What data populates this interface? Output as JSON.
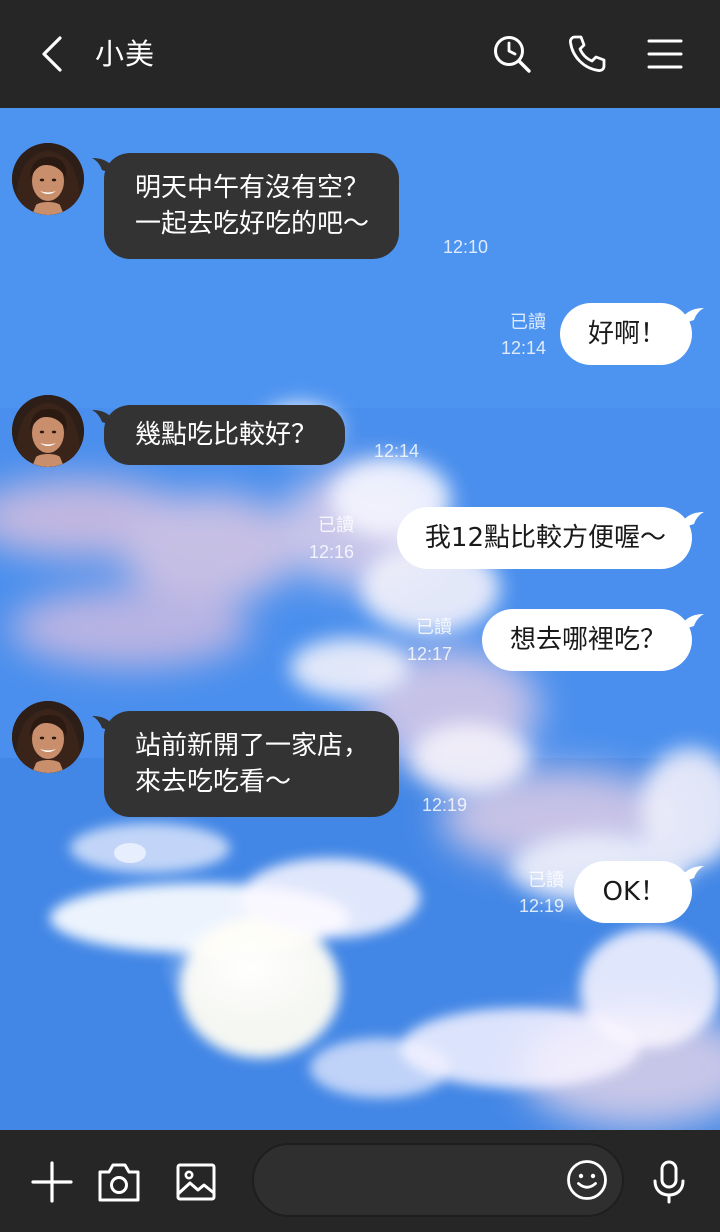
{
  "header": {
    "contact_name": "小美",
    "icons": [
      "back-chevron-icon",
      "search-clock-icon",
      "phone-icon",
      "menu-icon"
    ]
  },
  "messages": [
    {
      "from": "them",
      "lines": [
        "明天中午有沒有空？",
        "一起去吃好吃的吧～"
      ],
      "time": "12:10"
    },
    {
      "from": "me",
      "lines": [
        "好啊！"
      ],
      "read": "已讀",
      "time": "12:14"
    },
    {
      "from": "them",
      "lines": [
        "幾點吃比較好？"
      ],
      "time": "12:14"
    },
    {
      "from": "me",
      "lines": [
        "我12點比較方便喔～"
      ],
      "read": "已讀",
      "time": "12:16"
    },
    {
      "from": "me",
      "lines": [
        "想去哪裡吃？"
      ],
      "read": "已讀",
      "time": "12:17"
    },
    {
      "from": "them",
      "lines": [
        "站前新開了一家店，",
        "來去吃吃看～"
      ],
      "time": "12:19"
    },
    {
      "from": "me",
      "lines": [
        "OK！"
      ],
      "read": "已讀",
      "time": "12:19"
    }
  ],
  "composer": {
    "placeholder": "",
    "icons": [
      "plus-icon",
      "camera-icon",
      "image-icon",
      "emoji-icon",
      "microphone-icon"
    ]
  },
  "colors": {
    "bar_background": "#262626",
    "incoming_bubble": "#333333",
    "outgoing_bubble": "#ffffff",
    "sky": "#4a90ea"
  }
}
